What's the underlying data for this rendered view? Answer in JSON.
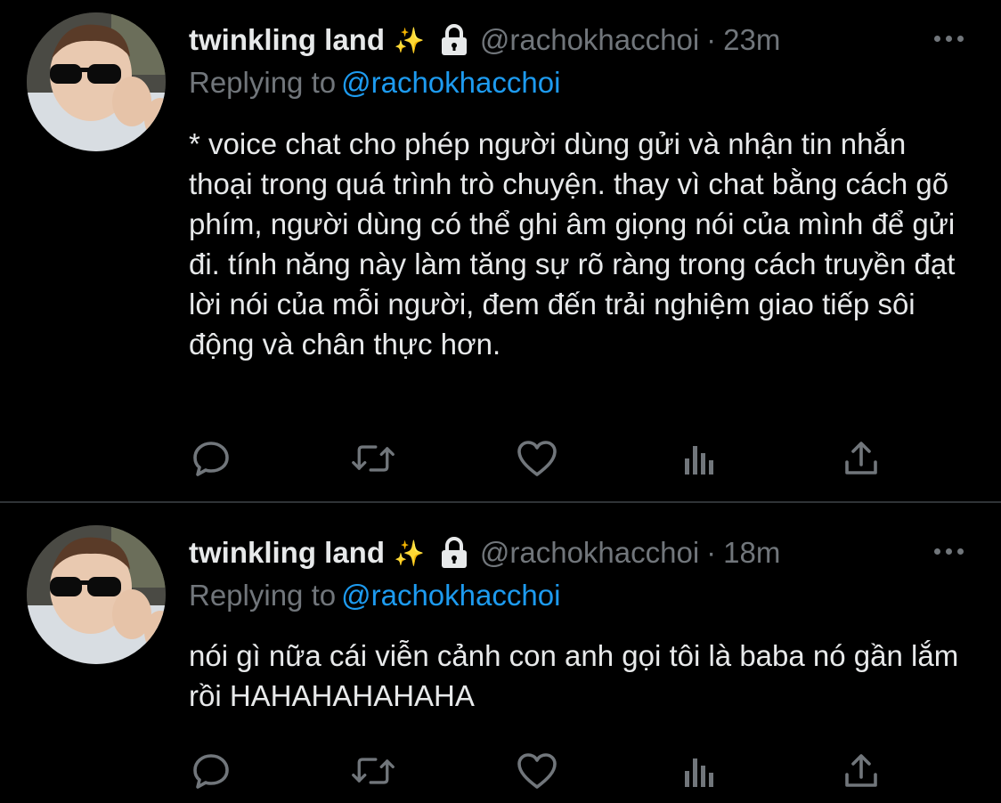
{
  "tweets": [
    {
      "name": "twinkling land",
      "emoji": "✨",
      "handle": "@rachokhacchoi",
      "separator": "·",
      "time": "23m",
      "replying_prefix": "Replying to",
      "replying_to": "@rachokhacchoi",
      "text": "* voice chat cho phép người dùng gửi và nhận tin nhắn thoại trong quá trình trò chuyện. thay vì chat bằng cách gõ phím, người dùng có thể ghi âm giọng nói của mình để gửi đi. tính năng này làm tăng sự rõ ràng trong cách truyền đạt lời nói của mỗi người, đem đến trải nghiệm giao tiếp sôi động và chân thực hơn."
    },
    {
      "name": "twinkling land",
      "emoji": "✨",
      "handle": "@rachokhacchoi",
      "separator": "·",
      "time": "18m",
      "replying_prefix": "Replying to",
      "replying_to": "@rachokhacchoi",
      "text": "nói gì nữa cái viễn cảnh con anh gọi tôi là baba nó gần lắm rồi HAHAHAHAHAHA"
    }
  ],
  "icons": {
    "more": "more-horizontal-icon",
    "lock": "lock-icon",
    "reply": "reply-icon",
    "retweet": "retweet-icon",
    "like": "like-icon",
    "analytics": "analytics-icon",
    "share": "share-icon"
  },
  "colors": {
    "background": "#000000",
    "text": "#e7e9ea",
    "muted": "#71767b",
    "link": "#1d9bf0",
    "divider": "#2f3336"
  }
}
